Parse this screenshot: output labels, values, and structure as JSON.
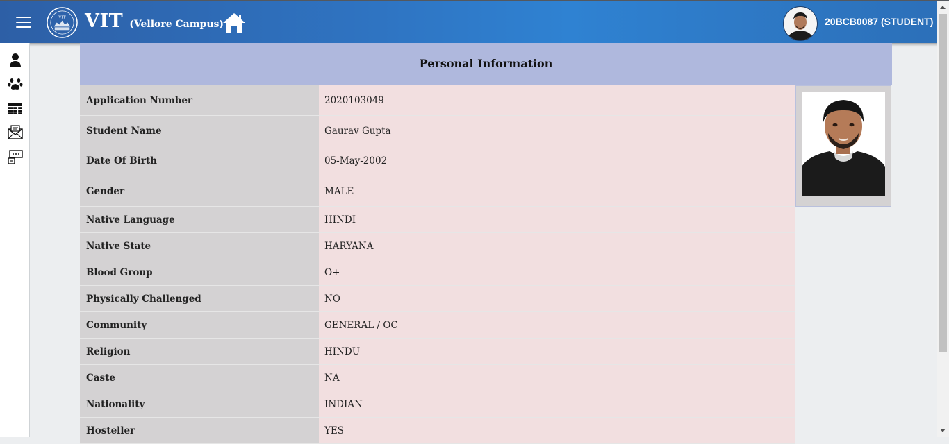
{
  "header": {
    "brand_title": "VIT",
    "brand_subtitle": "(Vellore Campus)",
    "logo_text": "VIT",
    "user_id": "20BCB0087 (STUDENT)",
    "menu_icon": "hamburger-menu-icon",
    "home_icon": "home-icon"
  },
  "sidebar": {
    "items": [
      {
        "icon": "user-icon"
      },
      {
        "icon": "paw-icon"
      },
      {
        "icon": "table-icon"
      },
      {
        "icon": "mail-icon"
      },
      {
        "icon": "message-board-icon"
      }
    ]
  },
  "section": {
    "title": "Personal Information"
  },
  "fields": [
    {
      "label": "Application Number",
      "value": "2020103049"
    },
    {
      "label": "Student Name",
      "value": "Gaurav Gupta"
    },
    {
      "label": "Date Of Birth",
      "value": "05-May-2002"
    },
    {
      "label": "Gender",
      "value": "MALE"
    },
    {
      "label": "Native Language",
      "value": "HINDI"
    },
    {
      "label": "Native State",
      "value": "HARYANA"
    },
    {
      "label": "Blood Group",
      "value": "O+"
    },
    {
      "label": "Physically Challenged",
      "value": "NO"
    },
    {
      "label": "Community",
      "value": "GENERAL / OC"
    },
    {
      "label": "Religion",
      "value": "HINDU"
    },
    {
      "label": "Caste",
      "value": "NA"
    },
    {
      "label": "Nationality",
      "value": "INDIAN"
    },
    {
      "label": "Hosteller",
      "value": "YES"
    }
  ],
  "colors": {
    "header_gradient": [
      "#2d5fa6",
      "#2f82d2"
    ],
    "section_header": "#afb8dd",
    "label_bg": "#d4d2d3",
    "value_bg": "#f2dfe0"
  }
}
